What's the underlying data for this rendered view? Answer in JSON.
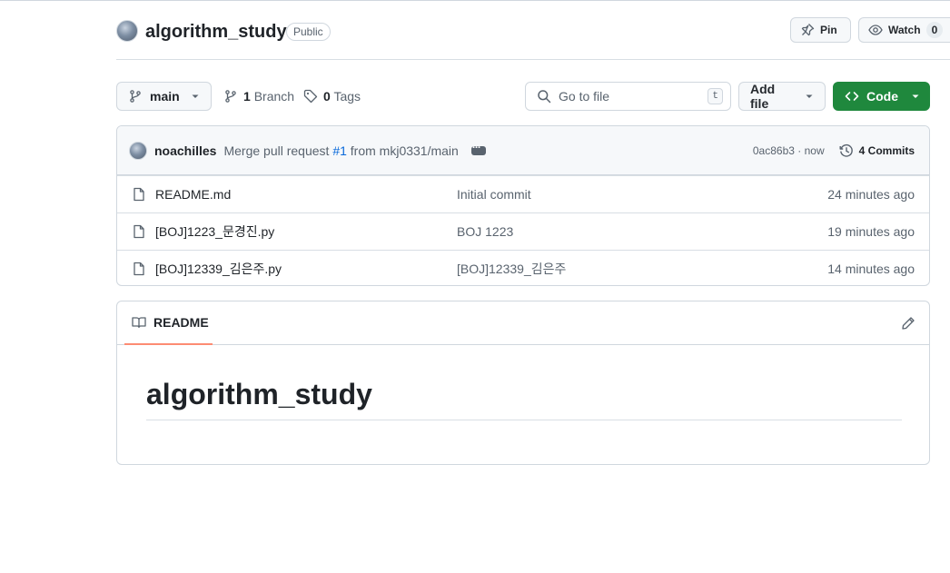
{
  "repo": {
    "name": "algorithm_study",
    "visibility": "Public",
    "pin_label": "Pin",
    "watch_label": "Watch",
    "watch_count": "0"
  },
  "toolbar": {
    "branch_name": "main",
    "branches_count": "1",
    "branches_label": "Branch",
    "tags_count": "0",
    "tags_label": "Tags",
    "search_placeholder": "Go to file",
    "search_shortcut": "t",
    "add_file_label": "Add file",
    "code_label": "Code"
  },
  "latest_commit": {
    "author": "noachilles",
    "message_prefix": "Merge pull request",
    "pr_ref": "#1",
    "message_suffix": "from mkj0331/main",
    "sha": "0ac86b3",
    "separator": "·",
    "time": "now",
    "commits_count": "4",
    "commits_label": "Commits"
  },
  "files": [
    {
      "name": "README.md",
      "commit": "Initial commit",
      "time": "24 minutes ago"
    },
    {
      "name": "[BOJ]1223_문경진.py",
      "commit": "BOJ 1223",
      "time": "19 minutes ago"
    },
    {
      "name": "[BOJ]12339_김은주.py",
      "commit": "[BOJ]12339_김은주",
      "time": "14 minutes ago"
    }
  ],
  "readme": {
    "tab_label": "README",
    "heading": "algorithm_study"
  },
  "colors": {
    "accent_green": "#1f883d",
    "link_blue": "#0969da",
    "tab_underline": "#fd8c73"
  }
}
